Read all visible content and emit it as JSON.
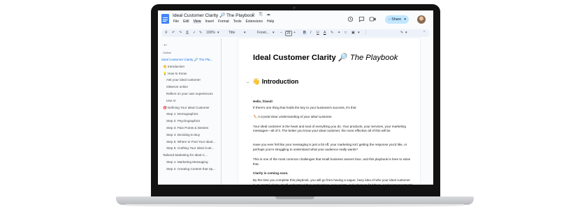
{
  "app": {
    "doc_title": "Ideal Customer Clarity 🔎 The Playbook",
    "title_icons": "☆ ⎘ ☁",
    "menu": [
      "File",
      "Edit",
      "View",
      "Insert",
      "Format",
      "Tools",
      "Extensions",
      "Help"
    ],
    "active_menu": "View",
    "share_label": "Share",
    "share_caret": "▾"
  },
  "toolbar": {
    "zoom": "100%",
    "style": "Title",
    "font": "Fonet...",
    "font_size": "25",
    "minus": "–",
    "plus": "+",
    "bold": "B",
    "italic": "I",
    "underline": "U",
    "text_color": "A",
    "more": "⋮"
  },
  "sidebar": {
    "back": "←",
    "outline_label": "Outline",
    "items": [
      {
        "label": "Ideal Customer Clarity 🔎 The Pla...",
        "level": 0,
        "active": true
      },
      {
        "label": "👋 Introduction",
        "level": 1,
        "active": false
      },
      {
        "label": "💡 How to Know",
        "level": 1,
        "active": false
      },
      {
        "label": "Ask your ideal customer",
        "level": 2,
        "active": false
      },
      {
        "label": "Observe online",
        "level": 2,
        "active": false
      },
      {
        "label": "Reflect on your own experiences",
        "level": 2,
        "active": false
      },
      {
        "label": "Use AI",
        "level": 2,
        "active": false
      },
      {
        "label": "🎯 Defining Your Ideal Customer",
        "level": 1,
        "active": false
      },
      {
        "label": "Step 1: Demographics",
        "level": 2,
        "active": false
      },
      {
        "label": "Step 2: Psychographics",
        "level": 2,
        "active": false
      },
      {
        "label": "Step 3: Pain Points & Desires",
        "level": 2,
        "active": false
      },
      {
        "label": "Step 4: Deciding to Buy",
        "level": 2,
        "active": false
      },
      {
        "label": "Step 5: Where to Find Your Ideal...",
        "level": 2,
        "active": false
      },
      {
        "label": "Step 6: Crafting Your Ideal Cust...",
        "level": 2,
        "active": false
      },
      {
        "label": "Tailored Marketing for Ideal C...",
        "level": 1,
        "active": false
      },
      {
        "label": "Step 1: Marketing Messaging",
        "level": 2,
        "active": false
      },
      {
        "label": "Step 2: Creating Content that Sp...",
        "level": 2,
        "active": false
      }
    ]
  },
  "document": {
    "title_main": "Ideal Customer Clarity 🔎",
    "title_italic": "The Playbook",
    "section_heading": "👋 Introduction",
    "section_dash": "–",
    "paragraphs": [
      {
        "text": "Hello, friend!",
        "style": "bold"
      },
      {
        "text": "If there's one thing that holds the key to your business's success, it's this:",
        "style": "normal"
      },
      {
        "text": "✏️ A crystal-clear understanding of your ideal customer.",
        "style": "italic"
      },
      {
        "text": "Your ideal customer is the heart and soul of everything you do. Your products, your services, your marketing messages—all of it. The better you know your ideal customer, the more effective all of this will be.",
        "style": "normal"
      },
      {
        "text": "Have you ever felt like your messaging is just a bit off, your marketing isn't getting the response you'd like, or perhaps you're struggling to understand what your audience really wants?",
        "style": "normal"
      },
      {
        "text": "This is one of the most common challenges that small business owners face, and this playbook is here to solve that.",
        "style": "normal"
      },
      {
        "text": "Clarity is coming soon.",
        "style": "bold"
      },
      {
        "text": "By the time you complete this playbook, you will go from having a vague, hazy idea of who your ideal customer is, to crystal clarity. You'll understand their motivations, pain points, and where to find them. And most importantly, you'll have a clear roadmap for how to communicate and sell to them in a way that",
        "style": "normal"
      }
    ]
  },
  "colors": {
    "accent_blue": "#1a73e8",
    "share_bg": "#c2e7ff",
    "toolbar_bg": "#edf2fa",
    "docs_logo": "#4285f4"
  }
}
